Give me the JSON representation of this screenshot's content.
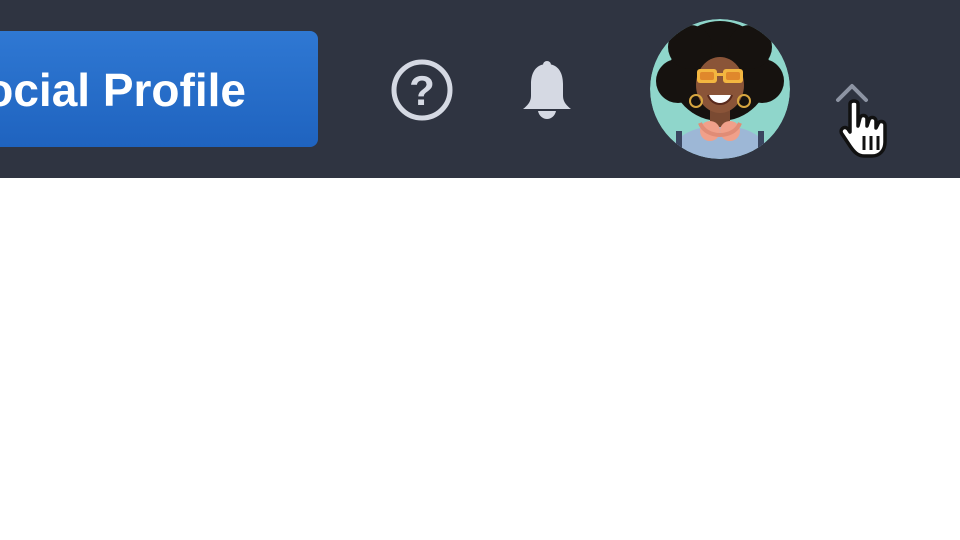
{
  "header": {
    "cta_label": "Social Profile",
    "help_label": "?",
    "colors": {
      "bar": "#2f3441",
      "cta": "#1f63bf",
      "icon": "#d5d9e3",
      "chevron": "#8d94a3"
    }
  },
  "icons": {
    "help": "question-circle-icon",
    "notifications": "bell-icon",
    "menu_toggle": "chevron-up-icon",
    "pointer": "hand-pointer-cursor-icon"
  }
}
